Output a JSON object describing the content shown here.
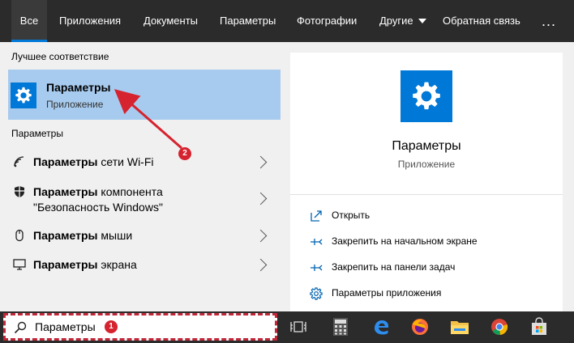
{
  "nav": {
    "tabs": [
      {
        "label": "Все"
      },
      {
        "label": "Приложения"
      },
      {
        "label": "Документы"
      },
      {
        "label": "Параметры"
      },
      {
        "label": "Фотографии"
      },
      {
        "label": "Другие"
      },
      {
        "label": "Обратная связь"
      }
    ],
    "more": "..."
  },
  "left": {
    "best_header": "Лучшее соответствие",
    "best": {
      "title": "Параметры",
      "subtitle": "Приложение"
    },
    "settings_header": "Параметры",
    "items": [
      {
        "bold": "Параметры",
        "rest": " сети Wi-Fi",
        "line2": ""
      },
      {
        "bold": "Параметры",
        "rest": " компонента",
        "line2": "\"Безопасность Windows\""
      },
      {
        "bold": "Параметры",
        "rest": " мыши",
        "line2": ""
      },
      {
        "bold": "Параметры",
        "rest": " экрана",
        "line2": ""
      }
    ]
  },
  "right": {
    "app_name": "Параметры",
    "app_type": "Приложение",
    "actions": [
      {
        "label": "Открыть"
      },
      {
        "label": "Закрепить на начальном экране"
      },
      {
        "label": "Закрепить на панели задач"
      },
      {
        "label": "Параметры приложения"
      }
    ]
  },
  "search": {
    "query": "Параметры"
  },
  "badges": {
    "one": "1",
    "two": "2"
  },
  "colors": {
    "accent": "#0078d7",
    "selected": "#a7cbee",
    "annotation": "#d5232f"
  }
}
